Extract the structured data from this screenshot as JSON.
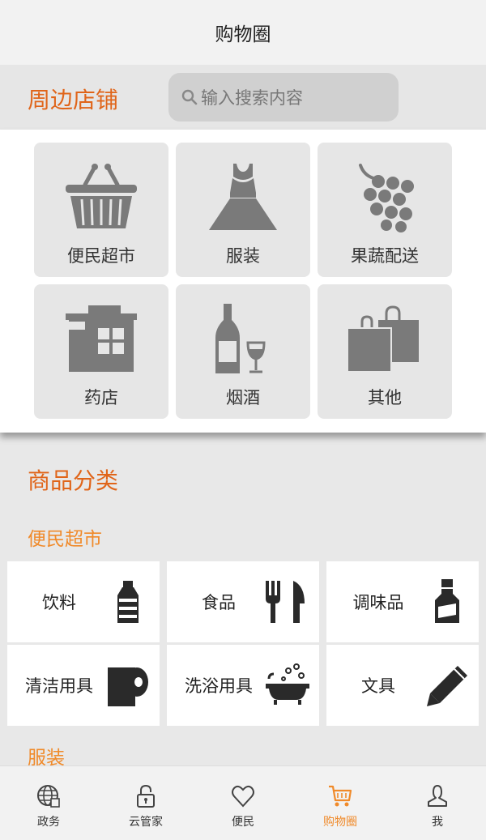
{
  "header": {
    "title": "购物圈"
  },
  "nearby": {
    "title": "周边店铺",
    "search_placeholder": "输入搜索内容",
    "shops": [
      {
        "label": "便民超市",
        "icon": "basket-icon"
      },
      {
        "label": "服装",
        "icon": "dress-icon"
      },
      {
        "label": "果蔬配送",
        "icon": "grapes-icon"
      },
      {
        "label": "药店",
        "icon": "store-icon"
      },
      {
        "label": "烟酒",
        "icon": "wine-icon"
      },
      {
        "label": "其他",
        "icon": "shopping-bags-icon"
      }
    ]
  },
  "categories": {
    "title": "商品分类",
    "groups": [
      {
        "title": "便民超市",
        "items": [
          {
            "label": "饮料",
            "icon": "bottle-icon"
          },
          {
            "label": "食品",
            "icon": "fork-knife-icon"
          },
          {
            "label": "调味品",
            "icon": "sauce-bottle-icon"
          },
          {
            "label": "清洁用具",
            "icon": "toilet-paper-icon"
          },
          {
            "label": "洗浴用具",
            "icon": "bathtub-icon"
          },
          {
            "label": "文具",
            "icon": "pencil-icon"
          }
        ]
      },
      {
        "title": "服装",
        "items": []
      }
    ]
  },
  "tabbar": {
    "active_color": "#f08a2a",
    "tabs": [
      {
        "label": "政务",
        "icon": "globe-icon"
      },
      {
        "label": "云管家",
        "icon": "lock-icon"
      },
      {
        "label": "便民",
        "icon": "heart-icon"
      },
      {
        "label": "购物圈",
        "icon": "cart-icon",
        "active": true
      },
      {
        "label": "我",
        "icon": "person-icon"
      }
    ]
  }
}
